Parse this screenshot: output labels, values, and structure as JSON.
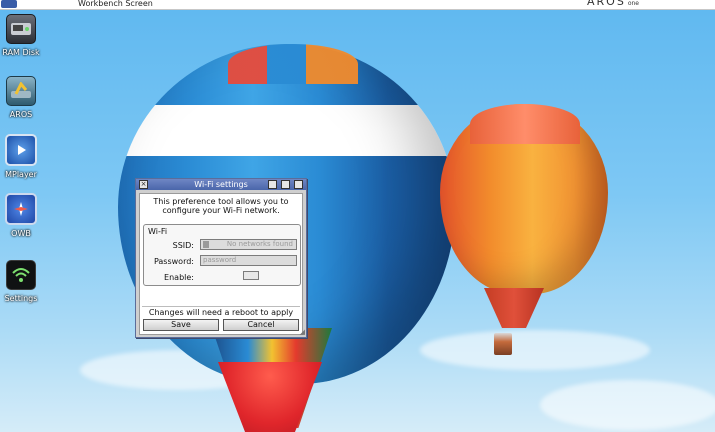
{
  "screen": {
    "title": "Workbench Screen",
    "logo": "AROS",
    "logo_small": "one"
  },
  "desktop_icons": [
    {
      "label": "RAM Disk",
      "icon": "disk-icon"
    },
    {
      "label": "AROS",
      "icon": "drive-icon"
    },
    {
      "label": "MPlayer",
      "icon": "play-icon"
    },
    {
      "label": "OWB",
      "icon": "compass-icon"
    },
    {
      "label": "Settings",
      "icon": "wifi-icon"
    }
  ],
  "window": {
    "title": "Wi-Fi settings",
    "description_line1": "This preference tool allows you to",
    "description_line2": "configure your Wi-Fi network.",
    "group_label": "Wi-Fi",
    "ssid_label": "SSID:",
    "ssid_value": "No networks found",
    "password_label": "Password:",
    "password_placeholder": "password",
    "enable_label": "Enable:",
    "note": "Changes will need a reboot to apply",
    "save_label": "Save",
    "cancel_label": "Cancel"
  },
  "colors": {
    "titlebar": "#4a66aa",
    "sky": "#5fb8f0"
  }
}
